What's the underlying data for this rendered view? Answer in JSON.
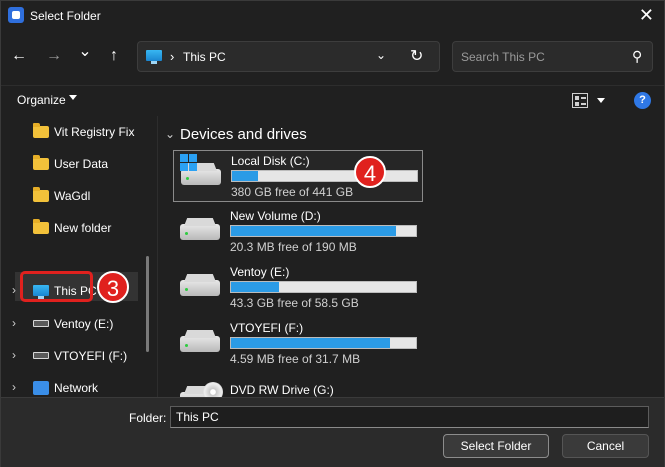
{
  "window": {
    "title": "Select Folder",
    "close_glyph": "✕"
  },
  "nav": {
    "back_glyph": "←",
    "forward_glyph": "→",
    "recent_glyph": "⌄",
    "up_glyph": "↑",
    "address_sep": "›",
    "address_text": "This PC",
    "address_chev": "⌄",
    "refresh_glyph": "↻",
    "search_placeholder": "Search This PC",
    "search_glyph": "⚲"
  },
  "toolbar": {
    "organize_label": "Organize",
    "help_glyph": "?"
  },
  "sidebar": {
    "items": [
      {
        "label": "Vit Registry Fix",
        "icon": "folder-icon"
      },
      {
        "label": "User Data",
        "icon": "folder-icon"
      },
      {
        "label": "WaGdl",
        "icon": "folder-icon"
      },
      {
        "label": "New folder",
        "icon": "folder-icon"
      },
      {
        "label": "This PC",
        "icon": "pc-icon",
        "chevron": "›"
      },
      {
        "label": "Ventoy (E:)",
        "icon": "drive-icon",
        "chevron": "›"
      },
      {
        "label": "VTOYEFI (F:)",
        "icon": "drive-icon",
        "chevron": "›"
      },
      {
        "label": "Network",
        "icon": "network-icon",
        "chevron": "›"
      }
    ]
  },
  "annotations": {
    "badge_sidebar": "3",
    "badge_drive": "4",
    "badge_color": "#e0211e"
  },
  "main": {
    "group_chev": "⌄",
    "group_title": "Devices and drives",
    "drives": [
      {
        "name": "Local Disk (C:)",
        "free": "380 GB free of 441 GB",
        "used_fraction": 0.14
      },
      {
        "name": "New Volume (D:)",
        "free": "20.3 MB free of 190 MB",
        "used_fraction": 0.89
      },
      {
        "name": "Ventoy (E:)",
        "free": "43.3 GB free of 58.5 GB",
        "used_fraction": 0.26
      },
      {
        "name": "VTOYEFI (F:)",
        "free": "4.59 MB free of 31.7 MB",
        "used_fraction": 0.86
      },
      {
        "name": "DVD RW Drive (G:)"
      }
    ]
  },
  "footer": {
    "folder_label": "Folder:",
    "folder_value": "This PC",
    "select_label": "Select Folder",
    "cancel_label": "Cancel"
  },
  "colors": {
    "accent": "#2b9be6",
    "background": "#202020",
    "footer": "#2b2b2b"
  }
}
